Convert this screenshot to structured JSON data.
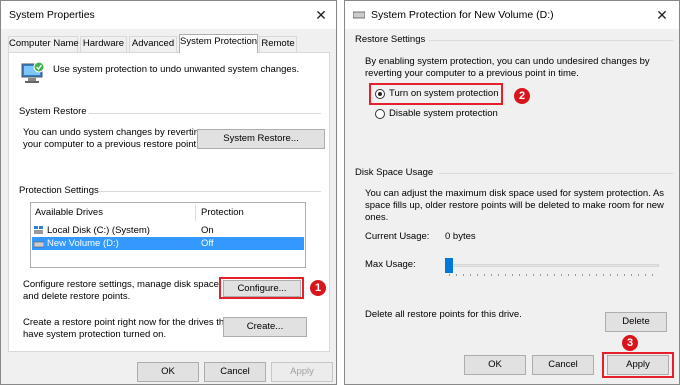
{
  "left": {
    "title": "System Properties",
    "tabs": [
      "Computer Name",
      "Hardware",
      "Advanced",
      "System Protection",
      "Remote"
    ],
    "intro_text": "Use system protection to undo unwanted system changes.",
    "restore_group": "System Restore",
    "restore_text": "You can undo system changes by reverting\nyour computer to a previous restore point.",
    "restore_button": "System Restore...",
    "protection_group": "Protection Settings",
    "col_drives": "Available Drives",
    "col_protection": "Protection",
    "drives": [
      {
        "name": "Local Disk (C:) (System)",
        "protection": "On"
      },
      {
        "name": "New Volume (D:)",
        "protection": "Off"
      }
    ],
    "configure_text": "Configure restore settings, manage disk space,\nand delete restore points.",
    "configure_button": "Configure...",
    "create_text": "Create a restore point right now for the drives that\nhave system protection turned on.",
    "create_button": "Create...",
    "ok": "OK",
    "cancel": "Cancel",
    "apply": "Apply",
    "badge": "1"
  },
  "right": {
    "title": "System Protection for New Volume (D:)",
    "restore_settings_group": "Restore Settings",
    "restore_settings_text": "By enabling system protection, you can undo undesired changes by\nreverting your computer to a previous point in time.",
    "radio_on": "Turn on system protection",
    "radio_off": "Disable system protection",
    "badge2": "2",
    "disk_group": "Disk Space Usage",
    "disk_text": "You can adjust the maximum disk space used for system protection. As\nspace fills up, older restore points will be deleted to make room for new\nones.",
    "current_usage_label": "Current Usage:",
    "current_usage_value": "0 bytes",
    "max_usage_label": "Max Usage:",
    "max_usage_level": 0,
    "delete_text": "Delete all restore points for this drive.",
    "delete_button": "Delete",
    "ok": "OK",
    "cancel": "Cancel",
    "apply": "Apply",
    "badge3": "3"
  },
  "colors": {
    "highlight": "#3399ff",
    "annotation_red": "#e5202a"
  }
}
